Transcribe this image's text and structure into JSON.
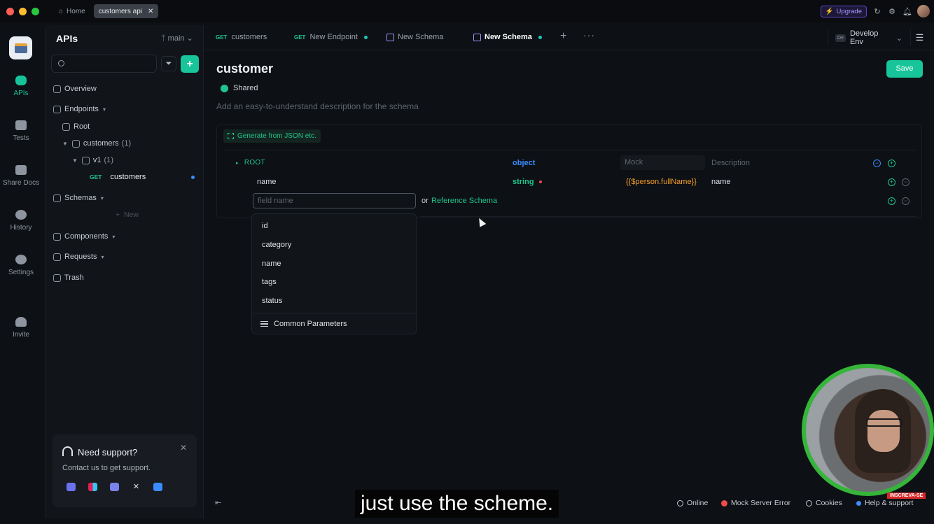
{
  "titlebar": {
    "home_label": "Home",
    "active_tab": "customers api",
    "upgrade_label": "Upgrade"
  },
  "rail": {
    "items": [
      {
        "label": "APIs",
        "icon": "api-icon",
        "active": true
      },
      {
        "label": "Tests",
        "icon": "tests-icon"
      },
      {
        "label": "Share Docs",
        "icon": "docs-icon"
      },
      {
        "label": "History",
        "icon": "history-icon"
      },
      {
        "label": "Settings",
        "icon": "settings-icon"
      },
      {
        "label": "Invite",
        "icon": "invite-icon"
      }
    ]
  },
  "sidebar": {
    "title": "APIs",
    "branch": "main",
    "tree": {
      "overview": "Overview",
      "endpoints": "Endpoints",
      "root": "Root",
      "customers_folder": "customers",
      "customers_count": "(1)",
      "v1_folder": "v1",
      "v1_count": "(1)",
      "endpoint_method": "GET",
      "endpoint_name": "customers",
      "schemas": "Schemas",
      "new_label": "New",
      "components": "Components",
      "requests": "Requests",
      "trash": "Trash"
    },
    "support": {
      "title": "Need support?",
      "text": "Contact us to get support."
    }
  },
  "tabs": [
    {
      "method": "GET",
      "label": "customers"
    },
    {
      "method": "GET",
      "label": "New Endpoint",
      "modified": true
    },
    {
      "label": "New Schema"
    },
    {
      "label": "New Schema",
      "active": true,
      "modified": true
    }
  ],
  "env": {
    "badge": "De",
    "label": "Develop Env"
  },
  "schema": {
    "title": "customer",
    "visibility": "Shared",
    "description_placeholder": "Add an easy-to-understand description for the schema",
    "save_label": "Save",
    "generate_label": "Generate from JSON etc.",
    "root_label": "ROOT",
    "root_type": "object",
    "mock_header": "Mock",
    "description_header": "Description",
    "fields": [
      {
        "name": "name",
        "type": "string",
        "mock": "{{$person.fullName}}",
        "description": "name"
      }
    ],
    "new_field_placeholder": "field name",
    "or_text": "or",
    "reference_label": "Reference Schema"
  },
  "dropdown": {
    "items": [
      "id",
      "category",
      "name",
      "tags",
      "status"
    ],
    "footer": "Common Parameters"
  },
  "statusbar": {
    "online": "Online",
    "mock_error": "Mock Server Error",
    "cookies": "Cookies",
    "help": "Help & support"
  },
  "overlay": {
    "subtitle": "just use the scheme.",
    "subscribe": "INSCREVA-SE"
  },
  "colors": {
    "accent": "#18c59b",
    "object_type": "#3b8cff",
    "mock_value": "#f59d2a",
    "error": "#ef4b4b"
  }
}
